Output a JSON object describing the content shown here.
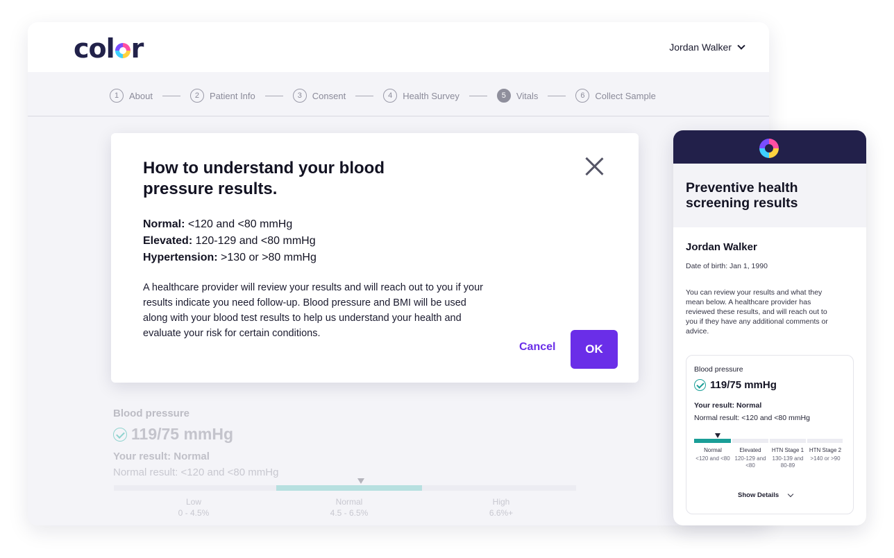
{
  "app": {
    "logo_text": "color",
    "user_name": "Jordan Walker"
  },
  "stepper": [
    {
      "num": "1",
      "label": "About",
      "active": false
    },
    {
      "num": "2",
      "label": "Patient Info",
      "active": false
    },
    {
      "num": "3",
      "label": "Consent",
      "active": false
    },
    {
      "num": "4",
      "label": "Health Survey",
      "active": false
    },
    {
      "num": "5",
      "label": "Vitals",
      "active": true
    },
    {
      "num": "6",
      "label": "Collect Sample",
      "active": false
    }
  ],
  "modal": {
    "title": "How to understand your blood pressure results.",
    "ranges": [
      {
        "label": "Normal:",
        "value": "<120 and <80 mmHg"
      },
      {
        "label": "Elevated:",
        "value": "120-129 and <80 mmHg"
      },
      {
        "label": "Hypertension:",
        "value": ">130 or >80 mmHg"
      }
    ],
    "description": "A healthcare provider will review your results and will reach out to you if your results indicate you need follow-up. Blood pressure and BMI will be used along with your blood test results to help us understand your health and evaluate your risk for certain conditions.",
    "cancel_label": "Cancel",
    "ok_label": "OK"
  },
  "background_result": {
    "label": "Blood pressure",
    "value": "119/75 mmHg",
    "result": "Your result: Normal",
    "normal_result": "Normal result: <120 and <80 mmHg",
    "scale": [
      {
        "name": "Low",
        "range": "0 - 4.5%"
      },
      {
        "name": "Normal",
        "range": "4.5 - 6.5%"
      },
      {
        "name": "High",
        "range": "6.6%+"
      }
    ]
  },
  "mobile": {
    "title": "Preventive health screening results",
    "name": "Jordan Walker",
    "dob": "Date of birth: Jan 1, 1990",
    "intro": "You can review your results and what they mean below. A healthcare provider has reviewed these results, and will reach out to you if they have any additional comments or advice.",
    "card": {
      "label": "Blood pressure",
      "value": "119/75 mmHg",
      "result": "Your result: Normal",
      "normal_result": "Normal result: <120 and <80 mmHg",
      "categories": [
        {
          "name": "Normal",
          "range": "<120 and <80"
        },
        {
          "name": "Elevated",
          "range": "120-129 and <80"
        },
        {
          "name": "HTN Stage 1",
          "range": "130-139 and 80-89"
        },
        {
          "name": "HTN Stage 2",
          "range": ">140 or >90"
        }
      ],
      "show_details": "Show Details"
    }
  },
  "colors": {
    "accent": "#6a2ee8",
    "teal": "#1a9e97",
    "navy": "#22204a"
  }
}
